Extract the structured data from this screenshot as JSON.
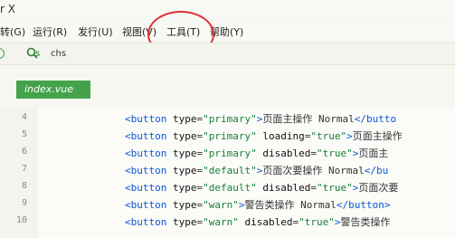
{
  "window": {
    "title": "r X"
  },
  "menu": {
    "items": [
      {
        "label": "转(G)"
      },
      {
        "label": "运行(R)"
      },
      {
        "label": "发行(U)"
      },
      {
        "label": "视图(V)"
      },
      {
        "label": "工具(T)"
      },
      {
        "label": "帮助(Y)"
      }
    ]
  },
  "toolbar": {
    "search_kind": "s",
    "search_value": "chs"
  },
  "tabs": [
    {
      "label": "index.vue"
    }
  ],
  "editor": {
    "lines": [
      {
        "number": "4",
        "parts": [
          {
            "text": "<button",
            "kind": "tag"
          },
          {
            "text": " type",
            "kind": "attr"
          },
          {
            "text": "=",
            "kind": "eq"
          },
          {
            "text": "\"primary\"",
            "kind": "value"
          },
          {
            "text": ">",
            "kind": "tag"
          },
          {
            "text": "页面主操作 Normal",
            "kind": "text"
          },
          {
            "text": "</butto",
            "kind": "tag"
          }
        ]
      },
      {
        "number": "5",
        "parts": [
          {
            "text": "<button",
            "kind": "tag"
          },
          {
            "text": " type",
            "kind": "attr"
          },
          {
            "text": "=",
            "kind": "eq"
          },
          {
            "text": "\"primary\"",
            "kind": "value"
          },
          {
            "text": " loading",
            "kind": "attr"
          },
          {
            "text": "=",
            "kind": "eq"
          },
          {
            "text": "\"true\"",
            "kind": "value"
          },
          {
            "text": ">",
            "kind": "tag"
          },
          {
            "text": "页面主操作",
            "kind": "text"
          }
        ]
      },
      {
        "number": "6",
        "parts": [
          {
            "text": "<button",
            "kind": "tag"
          },
          {
            "text": " type",
            "kind": "attr"
          },
          {
            "text": "=",
            "kind": "eq"
          },
          {
            "text": "\"primary\"",
            "kind": "value"
          },
          {
            "text": " disabled",
            "kind": "attr"
          },
          {
            "text": "=",
            "kind": "eq"
          },
          {
            "text": "\"true\"",
            "kind": "value"
          },
          {
            "text": ">",
            "kind": "tag"
          },
          {
            "text": "页面主",
            "kind": "text"
          }
        ]
      },
      {
        "number": "7",
        "parts": [
          {
            "text": "<button",
            "kind": "tag"
          },
          {
            "text": " type",
            "kind": "attr"
          },
          {
            "text": "=",
            "kind": "eq"
          },
          {
            "text": "\"default\"",
            "kind": "value"
          },
          {
            "text": ">",
            "kind": "tag"
          },
          {
            "text": "页面次要操作 Normal",
            "kind": "text"
          },
          {
            "text": "</bu",
            "kind": "tag"
          }
        ]
      },
      {
        "number": "8",
        "parts": [
          {
            "text": "<button",
            "kind": "tag"
          },
          {
            "text": " type",
            "kind": "attr"
          },
          {
            "text": "=",
            "kind": "eq"
          },
          {
            "text": "\"default\"",
            "kind": "value"
          },
          {
            "text": " disabled",
            "kind": "attr"
          },
          {
            "text": "=",
            "kind": "eq"
          },
          {
            "text": "\"true\"",
            "kind": "value"
          },
          {
            "text": ">",
            "kind": "tag"
          },
          {
            "text": "页面次要",
            "kind": "text"
          }
        ]
      },
      {
        "number": "9",
        "parts": [
          {
            "text": "<button",
            "kind": "tag"
          },
          {
            "text": " type",
            "kind": "attr"
          },
          {
            "text": "=",
            "kind": "eq"
          },
          {
            "text": "\"warn\"",
            "kind": "value"
          },
          {
            "text": ">",
            "kind": "tag"
          },
          {
            "text": "警告类操作 Normal",
            "kind": "text"
          },
          {
            "text": "</button>",
            "kind": "tag"
          }
        ]
      },
      {
        "number": "10",
        "parts": [
          {
            "text": "<button",
            "kind": "tag"
          },
          {
            "text": " type",
            "kind": "attr"
          },
          {
            "text": "=",
            "kind": "eq"
          },
          {
            "text": "\"warn\"",
            "kind": "value"
          },
          {
            "text": " disabled",
            "kind": "attr"
          },
          {
            "text": "=",
            "kind": "eq"
          },
          {
            "text": "\"true\"",
            "kind": "value"
          },
          {
            "text": ">",
            "kind": "tag"
          },
          {
            "text": "警告类操作",
            "kind": "text"
          }
        ]
      }
    ]
  },
  "colors": {
    "accent": "#44a34a",
    "highlight": "#dd3333"
  },
  "icons": {
    "search": "search-icon",
    "status": "circle-indicator-icon"
  }
}
